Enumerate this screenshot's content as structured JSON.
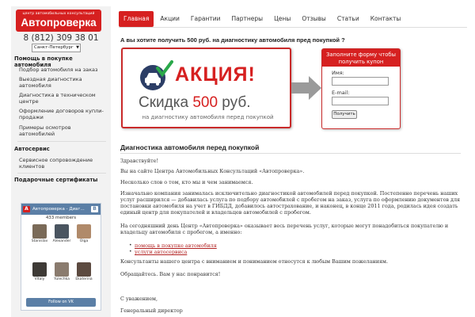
{
  "logo": {
    "tagline": "центр автомобильных консультаций",
    "name": "Автопроверка"
  },
  "phone": "8 (812) 309 38 01",
  "city_select": "Санкт-Петербург",
  "sidebar": {
    "section1": "Помощь в покупке автомобиля",
    "items1": [
      "Подбор автомобиля на заказ",
      "Выездная диагностика автомобиля",
      "Диагностика в техническом центре",
      "Оформление договоров купли-продажи",
      "Примеры осмотров автомобилей"
    ],
    "section2": "Автосервис",
    "items2": [
      "Сервисное сопровождение клиентов"
    ],
    "section3": "Подарочные сертификаты"
  },
  "vk": {
    "group": "Автопроверка - Диаг...",
    "count": "433 members",
    "members": [
      "Stanislav",
      "Alexander",
      "Olga",
      "Vitaly",
      "Yulechka",
      "Ekaterina"
    ],
    "follow": "Follow on VK"
  },
  "nav": [
    "Главная",
    "Акции",
    "Гарантии",
    "Партнеры",
    "Цены",
    "Отзывы",
    "Статьи",
    "Контакты"
  ],
  "promo": {
    "question": "А вы хотите получить 500 руб. на диагностику автомобиля пред покупкой ?",
    "akcia": "АКЦИЯ!",
    "skidka_prefix": "Скидка",
    "skidka_num": "500",
    "skidka_suffix": "руб.",
    "sub": "на диагностику автомобиля перед покупкой"
  },
  "form": {
    "header": "Заполните форму чтобы получить купон",
    "name_label": "Имя:",
    "email_label": "E-mail:",
    "submit": "Получить"
  },
  "article": {
    "title": "Диагностика автомобиля перед покупкой",
    "p1": "Здравствуйте!",
    "p2": "Вы на сайте Центра Автомобильных Консультаций «Автопроверка».",
    "p3": "Несколько слов о том, кто мы и чем занимаемся.",
    "p4": "Изначально компания занималась исключительно диагностикой автомобилей перед покупкой. Постепенно перечень наших услуг расширился — добавилась услуга по подбору автомобилей с пробегом на заказ, услуга по оформлению документов для постановки автомобиля на учет в ГИБДД, добавилось автострахование, и наконец, в конце 2011 года, родилась идея создать единый центр для покупателей и владельцев автомобилей с пробегом.",
    "p5": "На сегодняшний день Центр «Автопроверка» оказывает весь перечень услуг, которые могут понадобиться покупателю и владельцу автомобиля с пробегом, а именно:",
    "links": [
      "помощь в покупке автомобиля",
      "услуги автосервиса"
    ],
    "p6": "Консультанты нашего центра с вниманием и пониманием отнесутся к любым Вашим пожеланиям.",
    "p7": "Обращайтесь. Вам у нас понравится!",
    "p8": "С уважением,",
    "p9": "Генеральный директор"
  }
}
